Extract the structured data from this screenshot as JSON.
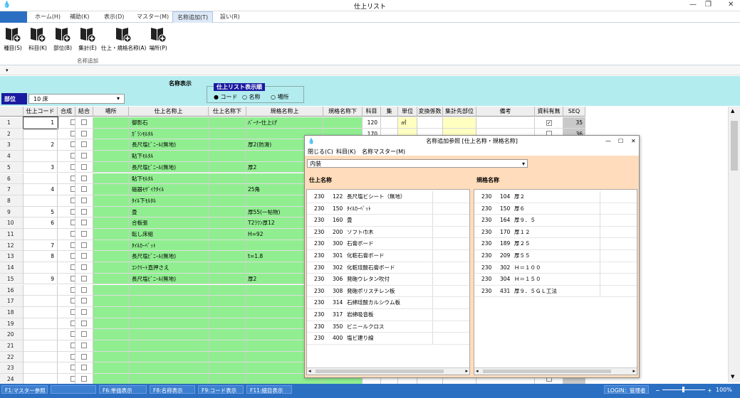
{
  "window": {
    "title": "仕上リスト"
  },
  "menu": {
    "tabs": [
      "ホーム(H)",
      "補助(K)",
      "表示(D)",
      "マスター(M)",
      "名称追加(T)",
      "設い(R)"
    ],
    "active": "名称追加(T)"
  },
  "ribbon": {
    "buttons": [
      "種目(S)",
      "科目(K)",
      "部位(B)",
      "集計(E)",
      "仕上・規格名称(A)",
      "場所(P)"
    ],
    "group": "名称追加"
  },
  "display": {
    "label": "名称表示",
    "order_title": "仕上リスト表示順",
    "options": [
      "コード",
      "名称",
      "場所"
    ],
    "selected": "コード"
  },
  "bui": {
    "label": "部位",
    "value": "10  床"
  },
  "grid": {
    "headers": [
      "仕上コード",
      "合成",
      "結合",
      "場所",
      "仕上名称上",
      "仕上名称下",
      "規格名称上",
      "規格名称下",
      "科目",
      "集",
      "単位",
      "変換係数",
      "集計先部位",
      "備考",
      "資料有無",
      "SEQ"
    ],
    "rows": [
      {
        "n": "1",
        "code": "1",
        "name": "御影石",
        "spec": "ﾊﾞｰﾅｰ仕上げ",
        "kamoku": "120",
        "unit": "㎡",
        "chk": true,
        "seq": "35"
      },
      {
        "n": "2",
        "code": "",
        "name": "ｶﾞﾗﾝﾓﾙﾀﾙ",
        "spec": "",
        "kamoku": "170",
        "unit": "",
        "chk": false,
        "seq": "36"
      },
      {
        "n": "3",
        "code": "2",
        "name": "長尺塩ﾋﾞﾆｰﾙ(無地)",
        "spec": "厚2(防滑)",
        "kamoku": "",
        "unit": "",
        "chk": false,
        "seq": ""
      },
      {
        "n": "4",
        "code": "",
        "name": "貼下ﾓﾙﾀﾙ",
        "spec": "",
        "kamoku": "",
        "unit": "",
        "chk": false,
        "seq": ""
      },
      {
        "n": "5",
        "code": "3",
        "name": "長尺塩ﾋﾞﾆｰﾙ(無地)",
        "spec": "厚2",
        "kamoku": "",
        "unit": "",
        "chk": false,
        "seq": ""
      },
      {
        "n": "6",
        "code": "",
        "name": "貼下ﾓﾙﾀﾙ",
        "spec": "",
        "kamoku": "",
        "unit": "",
        "chk": false,
        "seq": ""
      },
      {
        "n": "7",
        "code": "4",
        "name": "磁器ﾓｻﾞｲｸﾀｲﾙ",
        "spec": "25角",
        "kamoku": "",
        "unit": "",
        "chk": false,
        "seq": ""
      },
      {
        "n": "8",
        "code": "",
        "name": "ﾀｲﾙ下ﾓﾙﾀﾙ",
        "spec": "",
        "kamoku": "",
        "unit": "",
        "chk": false,
        "seq": ""
      },
      {
        "n": "9",
        "code": "5",
        "name": "畳",
        "spec": "厚55(一帖物)",
        "kamoku": "",
        "unit": "",
        "chk": false,
        "seq": ""
      },
      {
        "n": "10",
        "code": "6",
        "name": "合板張",
        "spec": "T2ﾗﾜﾝ厚12",
        "kamoku": "",
        "unit": "",
        "chk": false,
        "seq": ""
      },
      {
        "n": "11",
        "code": "",
        "name": "転し床組",
        "spec": "H=92",
        "kamoku": "",
        "unit": "",
        "chk": false,
        "seq": ""
      },
      {
        "n": "12",
        "code": "7",
        "name": "ﾀｲﾙｶｰﾍﾟｯﾄ",
        "spec": "",
        "kamoku": "",
        "unit": "",
        "chk": false,
        "seq": ""
      },
      {
        "n": "13",
        "code": "8",
        "name": "長尺塩ﾋﾞﾆｰﾙ(無地)",
        "spec": "t=1.8",
        "kamoku": "",
        "unit": "",
        "chk": false,
        "seq": ""
      },
      {
        "n": "14",
        "code": "",
        "name": "ｺﾝｸﾘｰﾄ直押さえ",
        "spec": "",
        "kamoku": "",
        "unit": "",
        "chk": false,
        "seq": ""
      },
      {
        "n": "15",
        "code": "9",
        "name": "長尺塩ﾋﾞﾆｰﾙ(無地)",
        "spec": "厚2",
        "kamoku": "",
        "unit": "",
        "chk": false,
        "seq": ""
      },
      {
        "n": "16",
        "code": "",
        "name": "",
        "spec": "",
        "kamoku": "",
        "unit": "",
        "chk": false,
        "seq": ""
      },
      {
        "n": "17",
        "code": "",
        "name": "",
        "spec": "",
        "kamoku": "",
        "unit": "",
        "chk": false,
        "seq": ""
      },
      {
        "n": "18",
        "code": "",
        "name": "",
        "spec": "",
        "kamoku": "",
        "unit": "",
        "chk": false,
        "seq": ""
      },
      {
        "n": "19",
        "code": "",
        "name": "",
        "spec": "",
        "kamoku": "",
        "unit": "",
        "chk": false,
        "seq": ""
      },
      {
        "n": "20",
        "code": "",
        "name": "",
        "spec": "",
        "kamoku": "",
        "unit": "",
        "chk": false,
        "seq": ""
      },
      {
        "n": "21",
        "code": "",
        "name": "",
        "spec": "",
        "kamoku": "",
        "unit": "",
        "chk": false,
        "seq": ""
      },
      {
        "n": "22",
        "code": "",
        "name": "",
        "spec": "",
        "kamoku": "",
        "unit": "",
        "chk": false,
        "seq": ""
      },
      {
        "n": "23",
        "code": "",
        "name": "",
        "spec": "",
        "kamoku": "",
        "unit": "",
        "chk": false,
        "seq": ""
      },
      {
        "n": "24",
        "code": "",
        "name": "",
        "spec": "",
        "kamoku": "",
        "unit": "",
        "chk": false,
        "seq": ""
      }
    ]
  },
  "dialog": {
    "title": "名称追加参照 [仕上名称・規格名称]",
    "menu": [
      "閉じる(C)",
      "科目(K)",
      "名称マスター(M)"
    ],
    "select": "内装",
    "left_header": "仕上名称",
    "right_header": "規格名称",
    "left_items": [
      [
        "230",
        "122",
        "長尺塩ビシート（無地）"
      ],
      [
        "230",
        "150",
        "ﾀｲﾙｶｰﾍﾟｯﾄ"
      ],
      [
        "230",
        "160",
        "畳"
      ],
      [
        "230",
        "200",
        "ソフト巾木"
      ],
      [
        "230",
        "300",
        "石膏ボード"
      ],
      [
        "230",
        "301",
        "化粧石膏ボード"
      ],
      [
        "230",
        "302",
        "化粧珪酸石膏ボード"
      ],
      [
        "230",
        "306",
        "発砲ウレタン吹付"
      ],
      [
        "230",
        "308",
        "発砲ポリスチレン板"
      ],
      [
        "230",
        "314",
        "石綿珪酸カルシウム板"
      ],
      [
        "230",
        "317",
        "岩綿吸音板"
      ],
      [
        "230",
        "350",
        "ビニールクロス"
      ],
      [
        "230",
        "400",
        "塩ビ建り線"
      ]
    ],
    "right_items": [
      [
        "230",
        "104",
        "厚２"
      ],
      [
        "230",
        "150",
        "厚６"
      ],
      [
        "230",
        "164",
        "厚９．５"
      ],
      [
        "230",
        "170",
        "厚１２"
      ],
      [
        "230",
        "189",
        "厚２５"
      ],
      [
        "230",
        "209",
        "厚５５"
      ],
      [
        "230",
        "302",
        "Ｈ＝１００"
      ],
      [
        "230",
        "304",
        "Ｈ＝１５０"
      ],
      [
        "230",
        "431",
        "厚９．５ＧＬ工法"
      ]
    ]
  },
  "statusbar": {
    "buttons": [
      "F1:マスター参照",
      "",
      "F6:単価表示",
      "F8:名称表示",
      "F9:コード表示",
      "F11:細目表示"
    ],
    "login": "LOGIN：管理者",
    "zoom": "100%"
  }
}
